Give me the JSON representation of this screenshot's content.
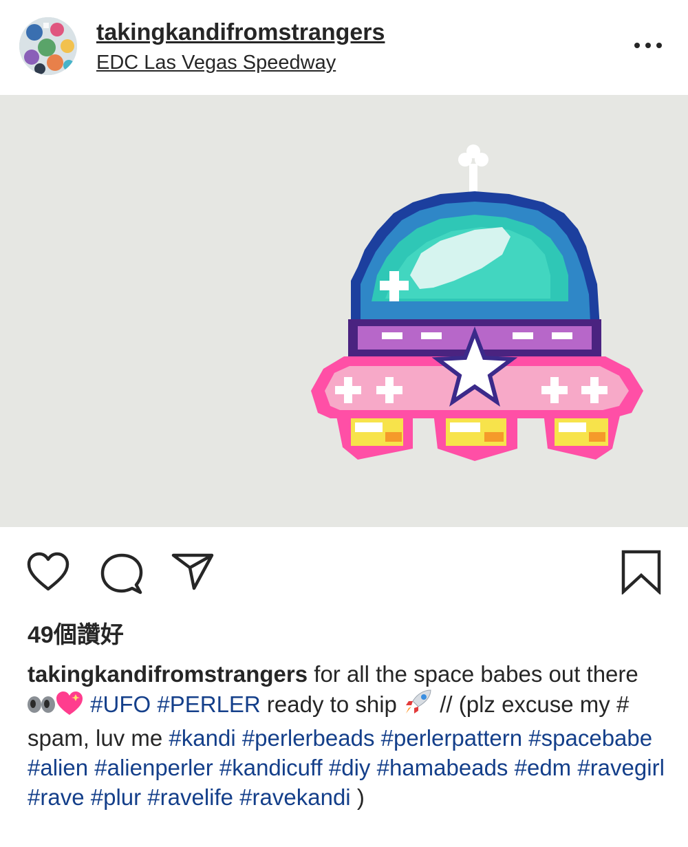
{
  "post": {
    "username": "takingkandifromstrangers",
    "location": "EDC Las Vegas Speedway",
    "likes_text": "49個讚好",
    "more_icon": "more-dots-icon",
    "photo_description_icon": "ufo-perler-bead-photo"
  },
  "actions": {
    "like_icon": "heart-icon",
    "comment_icon": "comment-icon",
    "share_icon": "paper-plane-icon",
    "save_icon": "bookmark-icon"
  },
  "caption": {
    "username": "takingkandifromstrangers",
    "text1": " for all the space babes out there ",
    "tag_ufo": "#UFO",
    "tag_perler": "#PERLER",
    "text2": " ready to ship ",
    "text3": " // (plz excuse my # spam, luv me ",
    "tag_kandi": "#kandi",
    "tag_perlerbeads": "#perlerbeads",
    "tag_perlerpattern": "#perlerpattern",
    "tag_spacebabe": "#spacebabe",
    "tag_alien": "#alien",
    "tag_alienperler": "#alienperler",
    "tag_kandicuff": "#kandicuff",
    "tag_diy": "#diy",
    "tag_hamabeads": "#hamabeads",
    "tag_edm": "#edm",
    "tag_ravegirl": "#ravegirl",
    "tag_rave": "#rave",
    "tag_plur": "#plur",
    "tag_ravelife": "#ravelife",
    "tag_ravekandi": "#ravekandi",
    "closing": " )"
  },
  "colors": {
    "text": "#262626",
    "hashtag": "#143f8a",
    "photo_bg": "#e6e7e3"
  }
}
